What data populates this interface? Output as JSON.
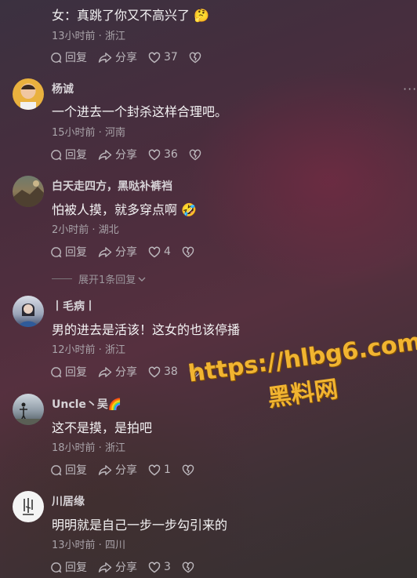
{
  "comments": [
    {
      "name": "",
      "text": "女：真跳了你又不高兴了 🤔",
      "meta": "13小时前 · 浙江",
      "reply": "回复",
      "share": "分享",
      "likes": "37"
    },
    {
      "name": "杨诚",
      "text": "一个进去一个封杀这样合理吧。",
      "meta": "15小时前 · 河南",
      "reply": "回复",
      "share": "分享",
      "likes": "36"
    },
    {
      "name": "白天走四方，黑哒补裤裆",
      "text": "怕被人摸，就多穿点啊 🤣",
      "meta": "2小时前 · 湖北",
      "reply": "回复",
      "share": "分享",
      "likes": "4"
    },
    {
      "name": "丨毛病丨",
      "text": "男的进去是活该！这女的也该停播",
      "meta": "12小时前 · 浙江",
      "reply": "回复",
      "share": "分享",
      "likes": "38"
    },
    {
      "name": "Uncle丶吴🌈",
      "text": "这不是摸，是拍吧",
      "meta": "18小时前 · 浙江",
      "reply": "回复",
      "share": "分享",
      "likes": "1"
    },
    {
      "name": "川居缘",
      "text": "明明就是自己一步一步勾引来的",
      "meta": "13小时前 · 四川",
      "reply": "回复",
      "share": "分享",
      "likes": "3"
    }
  ],
  "expand_replies": "展开1条回复",
  "more_glyph": "···",
  "watermark": {
    "url": "https://hlbg6.com",
    "name": "黑料网"
  },
  "colors": {
    "watermark": "#f1b431",
    "text": "#f4f3f4",
    "meta": "#a9a3a9"
  }
}
